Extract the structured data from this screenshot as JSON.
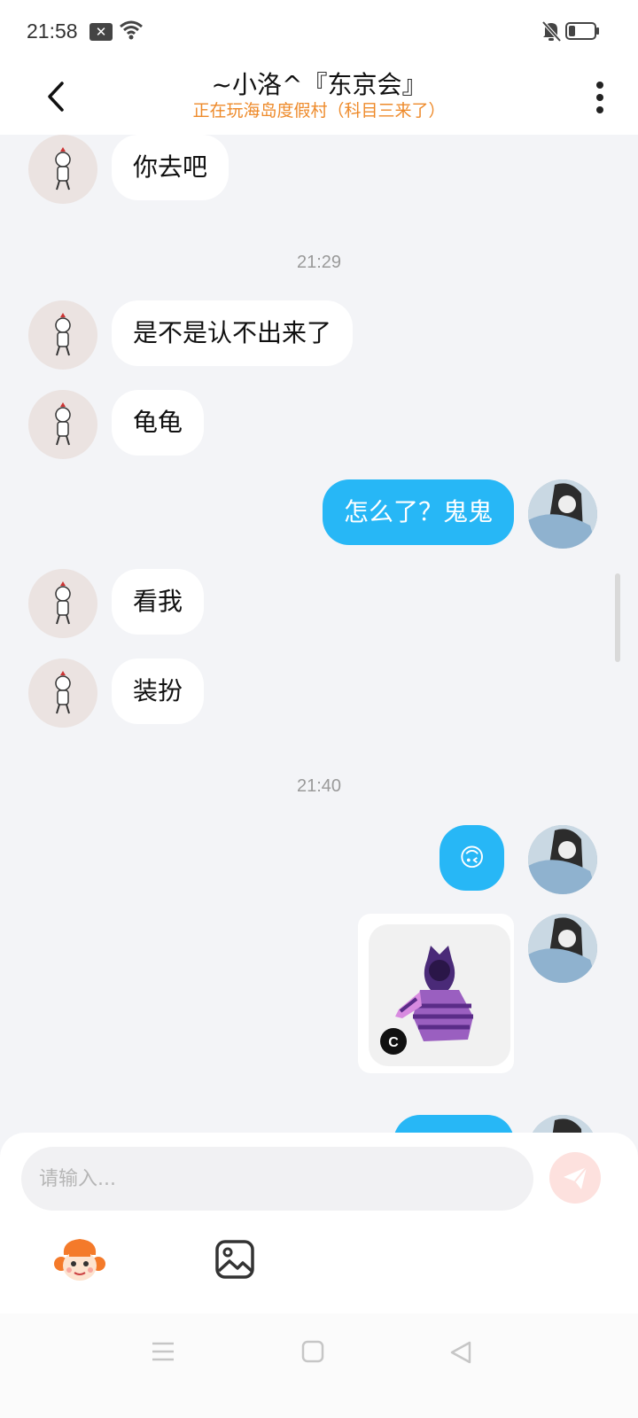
{
  "status_bar": {
    "time": "21:58",
    "notif_icon": "close-box-icon",
    "wifi_icon": "wifi-icon",
    "mute_icon": "bell-off-icon",
    "battery_icon": "battery-icon"
  },
  "header": {
    "title": "~小洛^『东京会』",
    "subtitle": "正在玩海岛度假村（科目三来了）",
    "back_icon": "chevron-left-icon",
    "more_icon": "more-vertical-icon"
  },
  "messages": [
    {
      "side": "in",
      "text": "你去吧"
    },
    {
      "side": "time",
      "text": "21:29"
    },
    {
      "side": "in",
      "text": "是不是认不出来了"
    },
    {
      "side": "in",
      "text": "龟龟"
    },
    {
      "side": "out",
      "text": "怎么了？鬼鬼"
    },
    {
      "side": "in",
      "text": "看我"
    },
    {
      "side": "in",
      "text": "装扮"
    },
    {
      "side": "time",
      "text": "21:40"
    },
    {
      "side": "out",
      "text": "🙃"
    },
    {
      "side": "out",
      "type": "image",
      "image": "purple-cat-hoodie-outfit"
    }
  ],
  "input": {
    "placeholder": "请输入..."
  },
  "toolbar": {
    "send_icon": "send-icon",
    "emoji_icon": "monkey-emoji-icon",
    "photo_icon": "image-icon"
  },
  "nav": {
    "menu_icon": "menu-icon",
    "home_icon": "square-home-icon",
    "back_icon": "triangle-back-icon"
  },
  "colors": {
    "accent": "#27b7f6",
    "subtitle": "#ee8a2a",
    "background": "#f3f4f7"
  }
}
